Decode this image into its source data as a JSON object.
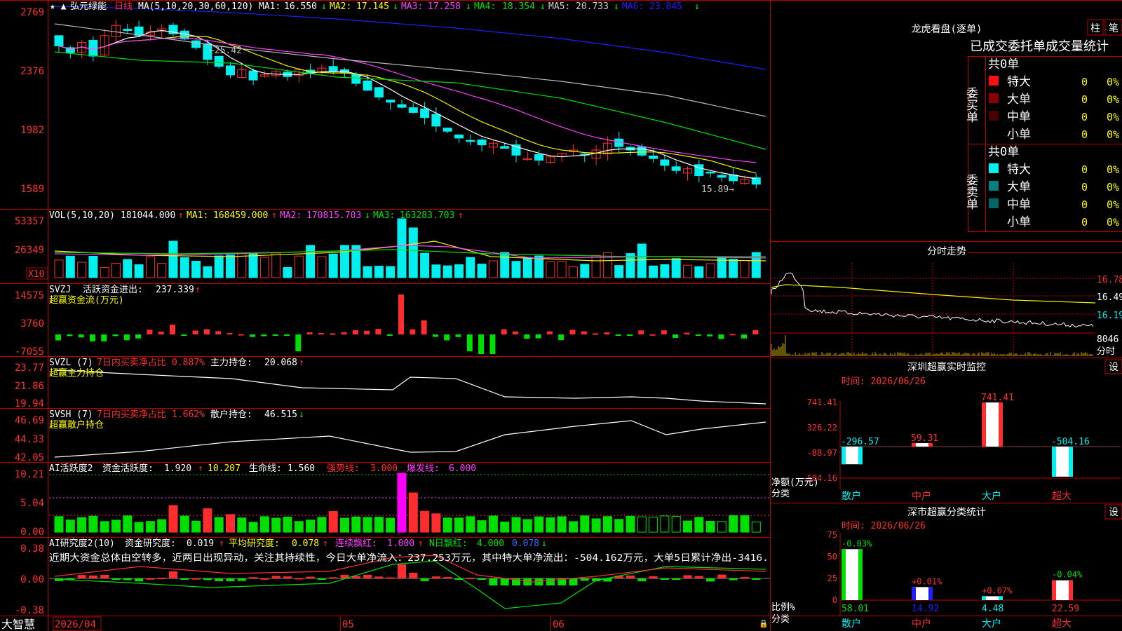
{
  "app": {
    "name": "大智慧",
    "star": "★ ▲"
  },
  "colors": {
    "bg": "#000000",
    "frame": "#c00000",
    "up": "#ff2d2d",
    "down": "#00f0f0",
    "green": "#00e000",
    "yellow": "#f0f000",
    "magenta": "#ff40ff",
    "white": "#ffffff",
    "gray": "#a8a8a8",
    "blue": "#2020ff"
  },
  "main": {
    "stock": "弘元绿能",
    "period": "日线",
    "ma_spec": "MA(5,10,20,30,60,120)",
    "ma": [
      {
        "label": "MA1:",
        "value": "16.550",
        "arrow": "↓"
      },
      {
        "label": "MA2:",
        "value": "17.145",
        "arrow": "↓"
      },
      {
        "label": "MA3:",
        "value": "17.258",
        "arrow": "↓"
      },
      {
        "label": "MA4:",
        "value": "18.354",
        "arrow": "↓"
      },
      {
        "label": "MA5:",
        "value": "20.733",
        "arrow": "↓"
      },
      {
        "label": "MA6:",
        "value": "23.845",
        "arrow": "↓"
      }
    ],
    "yticks": [
      "2769",
      "2376",
      "1982",
      "1589"
    ],
    "high_mark": "←25.42",
    "low_mark": "15.89→"
  },
  "vol": {
    "spec": "VOL(5,10,20)",
    "value": "181044.000",
    "value_arrow": "↑",
    "ma": [
      {
        "label": "MA1:",
        "value": "168459.000",
        "arrow": "↑"
      },
      {
        "label": "MA2:",
        "value": "170815.703",
        "arrow": "↓"
      },
      {
        "label": "MA3:",
        "value": "163283.703",
        "arrow": "↑"
      }
    ],
    "yticks": [
      "53357",
      "26349"
    ],
    "unit": "X10"
  },
  "svzj": {
    "name": "SVZJ",
    "label": "活跃资金进出:",
    "value": "237.339",
    "arrow": "↑",
    "sub": "超赢资金流(万元)",
    "yticks": [
      "14575",
      "3760",
      "-7055"
    ]
  },
  "svzl": {
    "name": "SVZL (7)",
    "ratio_label": "7日内买卖净占比",
    "ratio": "0.887%",
    "label": "主力持仓:",
    "value": "20.068",
    "arrow": "↑",
    "sub": "超赢主力持仓",
    "yticks": [
      "23.77",
      "21.86",
      "19.94"
    ]
  },
  "svsh": {
    "name": "SVSH (7)",
    "ratio_label": "7日内买卖净占比",
    "ratio": "1.662%",
    "label": "散户持仓:",
    "value": "46.515",
    "arrow": "↓",
    "sub": "超赢散户持仓",
    "yticks": [
      "46.69",
      "44.33",
      "42.05"
    ]
  },
  "ai1": {
    "name": "AI活跃度2",
    "label": "资金活跃度:",
    "value": "1.920",
    "arrow": "↑",
    "v2": "10.207",
    "life_label": "生命线:",
    "life": "1.560",
    "strong_label": "强势线:",
    "strong": "3.000",
    "burst_label": "爆发线:",
    "burst": "6.000",
    "yticks": [
      "10.21",
      "5.04",
      "0.00"
    ]
  },
  "ai2": {
    "name": "AI研究度2(10)",
    "label": "资金研究度:",
    "value": "0.019",
    "arrow": "↑",
    "avg_label": "平均研究度:",
    "avg": "0.078",
    "avg_arrow": "↑",
    "lian_label": "连续飘红:",
    "lian": "1.000",
    "lian_arrow": "↑",
    "n_label": "N日飘红:",
    "n": "4.000",
    "n2": "0.078",
    "n2_arrow": "↓",
    "note": "近期大资金总体由空转多，近两日出现异动，关注其持续性，今日大单净流入：237.253万元，其中特大单净流出：-504.162万元，大单5日累计净出-3416.",
    "yticks": [
      "0.38",
      "0.00",
      "-0.38"
    ]
  },
  "xaxis": {
    "start": "2026/04",
    "m5": "05",
    "m6": "06"
  },
  "lhb": {
    "title": "龙虎看盘(逐单)",
    "btn1": "柱",
    "btn2": "笔",
    "header": "已成交委托单成交量统计",
    "buy": {
      "total": "共0单",
      "side": "委买单",
      "rows": [
        {
          "name": "特大",
          "count": "0",
          "pct": "0%"
        },
        {
          "name": "大单",
          "count": "0",
          "pct": "0%"
        },
        {
          "name": "中单",
          "count": "0",
          "pct": "0%"
        },
        {
          "name": "小单",
          "count": "0",
          "pct": "0%"
        }
      ]
    },
    "sell": {
      "total": "共0单",
      "side": "委卖单",
      "rows": [
        {
          "name": "特大",
          "count": "0",
          "pct": "0%"
        },
        {
          "name": "大单",
          "count": "0",
          "pct": "0%"
        },
        {
          "name": "中单",
          "count": "0",
          "pct": "0%"
        },
        {
          "name": "小单",
          "count": "0",
          "pct": "0%"
        }
      ]
    }
  },
  "intraday": {
    "title": "分时走势",
    "yticks": [
      "16.78",
      "16.49",
      "16.19"
    ],
    "vol_tick": "8046",
    "vol_label": "分时"
  },
  "monitor": {
    "title": "深圳超赢实时监控",
    "btn": "设",
    "time": "时间: 2026/06/26",
    "yticks": [
      "741.41",
      "326.22",
      "-88.97",
      "-504.16"
    ],
    "ylabel": "净额(万元)",
    "xlabel": "分类",
    "categories": [
      "散户",
      "中户",
      "大户",
      "超大"
    ],
    "values": [
      -296.57,
      59.31,
      741.41,
      -504.16
    ],
    "value_labels": [
      "-296.57",
      "59.31",
      "741.41",
      "-504.16"
    ]
  },
  "stats": {
    "title": "深市超赢分类统计",
    "btn": "设",
    "time": "时间: 2026/06/26",
    "yticks": [
      "75",
      "50",
      "25",
      "0"
    ],
    "ylabel": "比例%",
    "xlabel": "分类",
    "categories": [
      "散户",
      "中户",
      "大户",
      "超大"
    ],
    "values": [
      58.01,
      14.92,
      4.48,
      22.59
    ],
    "value_labels": [
      "58.01",
      "14.92",
      "4.48",
      "22.59"
    ],
    "changes": [
      "-0.03%",
      "+0.01%",
      "+0.07%",
      "-0.04%"
    ]
  }
}
